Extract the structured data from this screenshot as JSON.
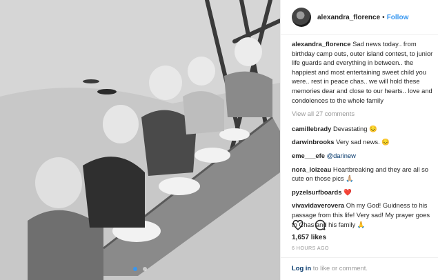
{
  "header": {
    "username": "alexandra_florence",
    "separator": "•",
    "follow_label": "Follow"
  },
  "caption": {
    "username": "alexandra_florence",
    "text": "Sad news today.. from birthday camp outs, outer island contest, to junior life guards and everything in between.. the happiest and most entertaining sweet child you were.. rest in peace chas.. we will hold these memories dear and close to our hearts.. love and condolences to the whole family"
  },
  "view_all": "View all 27 comments",
  "comments": [
    {
      "user": "camillebrady",
      "text": "Devastating 😔"
    },
    {
      "user": "darwinbrooks",
      "text": "Very sad news. 😔"
    },
    {
      "user": "eme___efe",
      "text": "",
      "mention": "@darinew"
    },
    {
      "user": "nora_loizeau",
      "text": "Heartbreaking and they are all so cute on those pics 🙏🏼"
    },
    {
      "user": "pyzelsurfboards",
      "text": "❤️"
    },
    {
      "user": "vivavidaverovera",
      "text": "Oh my God! Guidness to his passage from this life! Very sad! My prayer goes to Chas and his family 🙏"
    }
  ],
  "likes": "1,657 likes",
  "timestamp": "6 HOURS AGO",
  "footer": {
    "login_label": "Log in",
    "rest": " to like or comment."
  },
  "icons": {
    "like": "heart-outline-icon",
    "comment": "speech-bubble-icon"
  },
  "carousel": {
    "count": 2,
    "active_index": 0
  },
  "colors": {
    "link": "#3897f0",
    "mention": "#003569",
    "muted": "#999999"
  }
}
